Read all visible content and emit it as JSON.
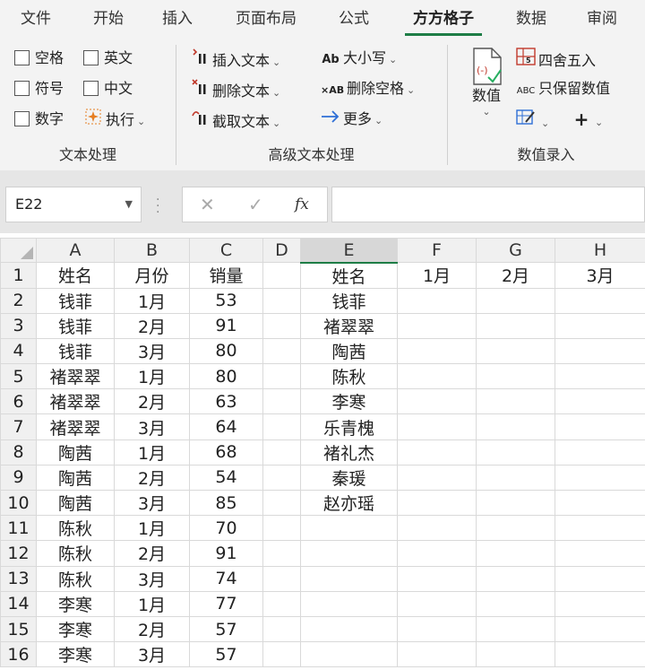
{
  "menu": {
    "tabs": [
      {
        "label": "文件",
        "active": false
      },
      {
        "label": "开始",
        "active": false
      },
      {
        "label": "插入",
        "active": false
      },
      {
        "label": "页面布局",
        "active": false
      },
      {
        "label": "公式",
        "active": false
      },
      {
        "label": "方方格子",
        "active": true
      },
      {
        "label": "数据",
        "active": false
      },
      {
        "label": "审阅",
        "active": false
      }
    ]
  },
  "ribbon": {
    "text_group": {
      "label": "文本处理",
      "checkboxes": {
        "space": "空格",
        "english": "英文",
        "symbol": "符号",
        "chinese": "中文",
        "digit": "数字"
      },
      "execute": "执行"
    },
    "advanced_group": {
      "label": "高级文本处理",
      "insert_text": "插入文本",
      "delete_text": "删除文本",
      "extract_text": "截取文本",
      "case_text": "大小写",
      "remove_spaces": "删除空格",
      "more": "更多",
      "case_icon": "Ab",
      "remove_icon": "×AB"
    },
    "value_group": {
      "label": "数值录入",
      "value_button": "数值",
      "round": "四舍五入",
      "keep_value": "只保留数值",
      "keep_icon": "ABC"
    }
  },
  "formula_bar": {
    "cell_ref": "E22",
    "cancel": "✕",
    "confirm": "✓",
    "fx": "fx",
    "content": ""
  },
  "sheet": {
    "columns": [
      "A",
      "B",
      "C",
      "D",
      "E",
      "F",
      "G",
      "H"
    ],
    "selected_column": "E",
    "rows": [
      [
        "姓名",
        "月份",
        "销量",
        "",
        "姓名",
        "1月",
        "2月",
        "3月"
      ],
      [
        "钱菲",
        "1月",
        "53",
        "",
        "钱菲",
        "",
        "",
        ""
      ],
      [
        "钱菲",
        "2月",
        "91",
        "",
        "褚翠翠",
        "",
        "",
        ""
      ],
      [
        "钱菲",
        "3月",
        "80",
        "",
        "陶茜",
        "",
        "",
        ""
      ],
      [
        "褚翠翠",
        "1月",
        "80",
        "",
        "陈秋",
        "",
        "",
        ""
      ],
      [
        "褚翠翠",
        "2月",
        "63",
        "",
        "李寒",
        "",
        "",
        ""
      ],
      [
        "褚翠翠",
        "3月",
        "64",
        "",
        "乐青槐",
        "",
        "",
        ""
      ],
      [
        "陶茜",
        "1月",
        "68",
        "",
        "褚礼杰",
        "",
        "",
        ""
      ],
      [
        "陶茜",
        "2月",
        "54",
        "",
        "秦瑗",
        "",
        "",
        ""
      ],
      [
        "陶茜",
        "3月",
        "85",
        "",
        "赵亦瑶",
        "",
        "",
        ""
      ],
      [
        "陈秋",
        "1月",
        "70",
        "",
        "",
        "",
        "",
        ""
      ],
      [
        "陈秋",
        "2月",
        "91",
        "",
        "",
        "",
        "",
        ""
      ],
      [
        "陈秋",
        "3月",
        "74",
        "",
        "",
        "",
        "",
        ""
      ],
      [
        "李寒",
        "1月",
        "77",
        "",
        "",
        "",
        "",
        ""
      ],
      [
        "李寒",
        "2月",
        "57",
        "",
        "",
        "",
        "",
        ""
      ],
      [
        "李寒",
        "3月",
        "57",
        "",
        "",
        "",
        "",
        ""
      ]
    ]
  },
  "colors": {
    "accent": "#1e7d46",
    "ribbon_bg": "#f3f3f3",
    "grid_line": "#d9d9d9",
    "header_bg": "#f0f0f0"
  }
}
